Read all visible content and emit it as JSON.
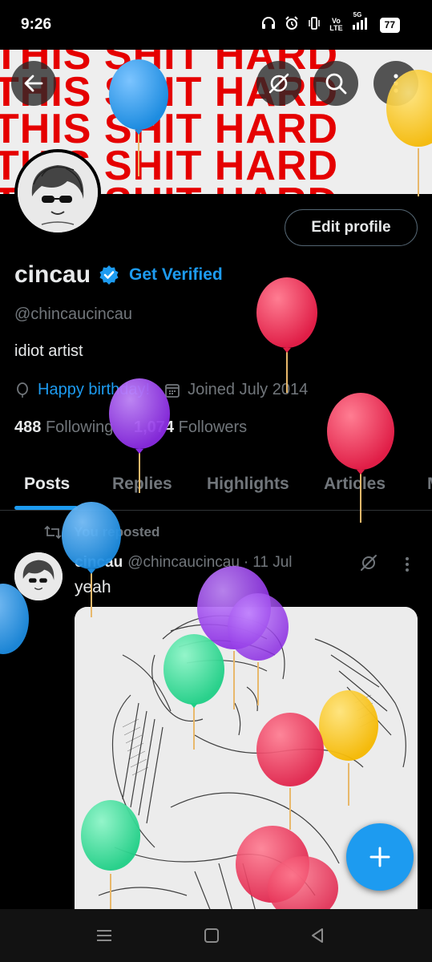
{
  "status_bar": {
    "time": "9:26",
    "network_label_1": "Vo\nLTE",
    "network_label_2": "5G",
    "battery": "77"
  },
  "banner": {
    "text": "THIS SHIT HARD",
    "text_color": "#e50000",
    "background": "#eeeeee"
  },
  "profile": {
    "display_name": "cincau",
    "get_verified_label": "Get Verified",
    "handle": "@chincaucincau",
    "bio": "idiot artist",
    "birthday_label": "Happy birthday!",
    "joined_label": "Joined July 2014",
    "following_count": "488",
    "following_label": "Following",
    "followers_count": "1,074",
    "followers_label": "Followers",
    "edit_profile_label": "Edit profile",
    "accent": "#1d9bf0"
  },
  "tabs": [
    {
      "label": "Posts",
      "active": true
    },
    {
      "label": "Replies",
      "active": false
    },
    {
      "label": "Highlights",
      "active": false
    },
    {
      "label": "Articles",
      "active": false
    },
    {
      "label": "M",
      "active": false
    }
  ],
  "post": {
    "reposted_label": "You reposted",
    "author": "cincau",
    "handle": "@chincaucincau",
    "dot": "·",
    "time": "11 Jul",
    "text": "yeah"
  },
  "icons": {
    "back": "arrow-left-icon",
    "grok": "grok-icon",
    "search": "search-icon",
    "more": "more-vertical-icon",
    "fab": "plus-icon"
  }
}
